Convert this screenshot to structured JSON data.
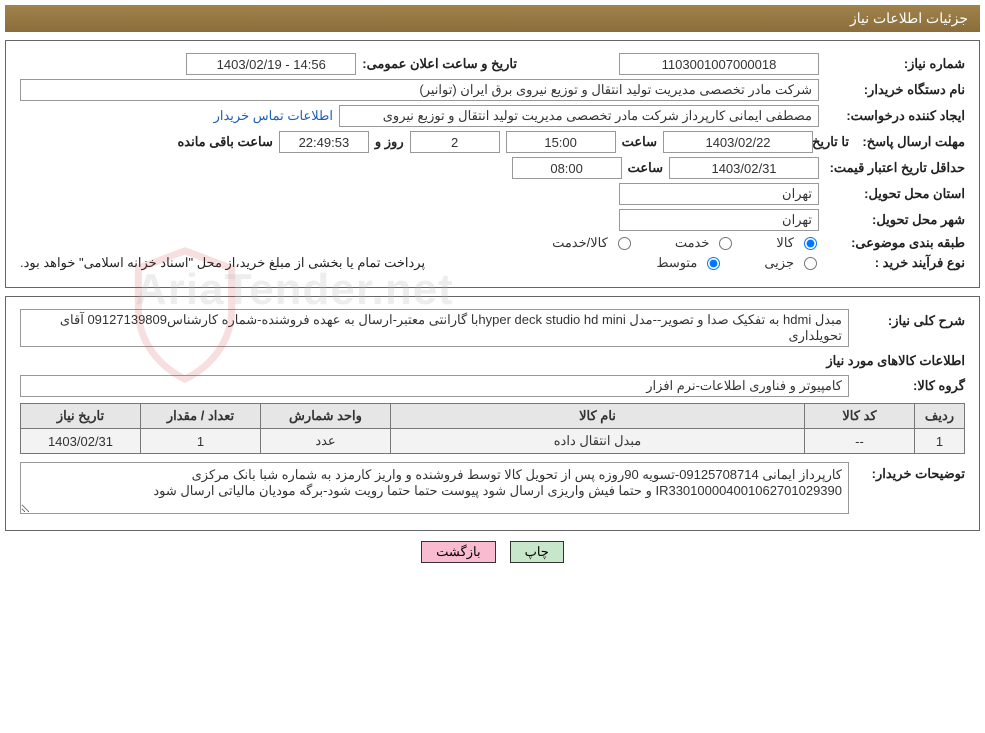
{
  "header": {
    "title": "جزئیات اطلاعات نیاز"
  },
  "need": {
    "number_label": "شماره نیاز:",
    "number": "1103001007000018",
    "announce_label": "تاریخ و ساعت اعلان عمومی:",
    "announce_value": "14:56 - 1403/02/19",
    "buyer_org_label": "نام دستگاه خریدار:",
    "buyer_org": "شرکت مادر تخصصی مدیریت تولید  انتقال و توزیع نیروی برق ایران (توانیر)",
    "requester_label": "ایجاد کننده درخواست:",
    "requester": "مصطفی ایمانی کارپرداز شرکت مادر تخصصی مدیریت تولید  انتقال و توزیع نیروی",
    "contact_link": "اطلاعات تماس خریدار",
    "deadline_label": "مهلت ارسال پاسخ:",
    "to_date_label": "تا تاریخ:",
    "deadline_date": "1403/02/22",
    "hour_label": "ساعت",
    "deadline_time": "15:00",
    "days_label": "روز و",
    "days_remaining": "2",
    "countdown": "22:49:53",
    "remaining_label": "ساعت باقی مانده",
    "validity_label": "حداقل تاریخ اعتبار قیمت:",
    "validity_date": "1403/02/31",
    "validity_time": "08:00",
    "province_label": "استان محل تحویل:",
    "province": "تهران",
    "city_label": "شهر محل تحویل:",
    "city": "تهران",
    "category_label": "طبقه بندی موضوعی:",
    "cat_goods": "کالا",
    "cat_service": "خدمت",
    "cat_both": "کالا/خدمت",
    "process_label": "نوع فرآیند خرید :",
    "proc_partial": "جزیی",
    "proc_medium": "متوسط",
    "payment_note": "پرداخت تمام یا بخشی از مبلغ خرید،از محل \"اسناد خزانه اسلامی\" خواهد بود."
  },
  "detail": {
    "subject_label": "شرح کلی نیاز:",
    "subject": "مبدل hdmi به تفکیک صدا و تصویر--مدل  hyper deck studio hd miniبا گارانتی معتبر-ارسال به عهده فروشنده-شماره کارشناس09127139809 آقای تحویلداری",
    "items_section": "اطلاعات کالاهای مورد نیاز",
    "group_label": "گروه کالا:",
    "group": "کامپیوتر و فناوری اطلاعات-نرم افزار",
    "table": {
      "headers": {
        "row": "ردیف",
        "code": "کد کالا",
        "name": "نام کالا",
        "unit": "واحد شمارش",
        "qty": "تعداد / مقدار",
        "date": "تاریخ نیاز"
      },
      "rows": [
        {
          "row": "1",
          "code": "--",
          "name": "مبدل انتقال داده",
          "unit": "عدد",
          "qty": "1",
          "date": "1403/02/31"
        }
      ]
    },
    "buyer_desc_label": "توضیحات خریدار:",
    "buyer_desc": "کارپرداز ایمانی 09125708714-تسویه 90روزه پس از تحویل کالا توسط فروشنده و واریز کارمزد به شماره شبا بانک مرکزی IR330100004001062701029390 و حتما فیش واریزی ارسال شود پیوست حتما حتما رویت شود-برگه مودیان مالیاتی ارسال شود"
  },
  "buttons": {
    "print": "چاپ",
    "back": "بازگشت"
  },
  "watermark": "AriaTender.net"
}
